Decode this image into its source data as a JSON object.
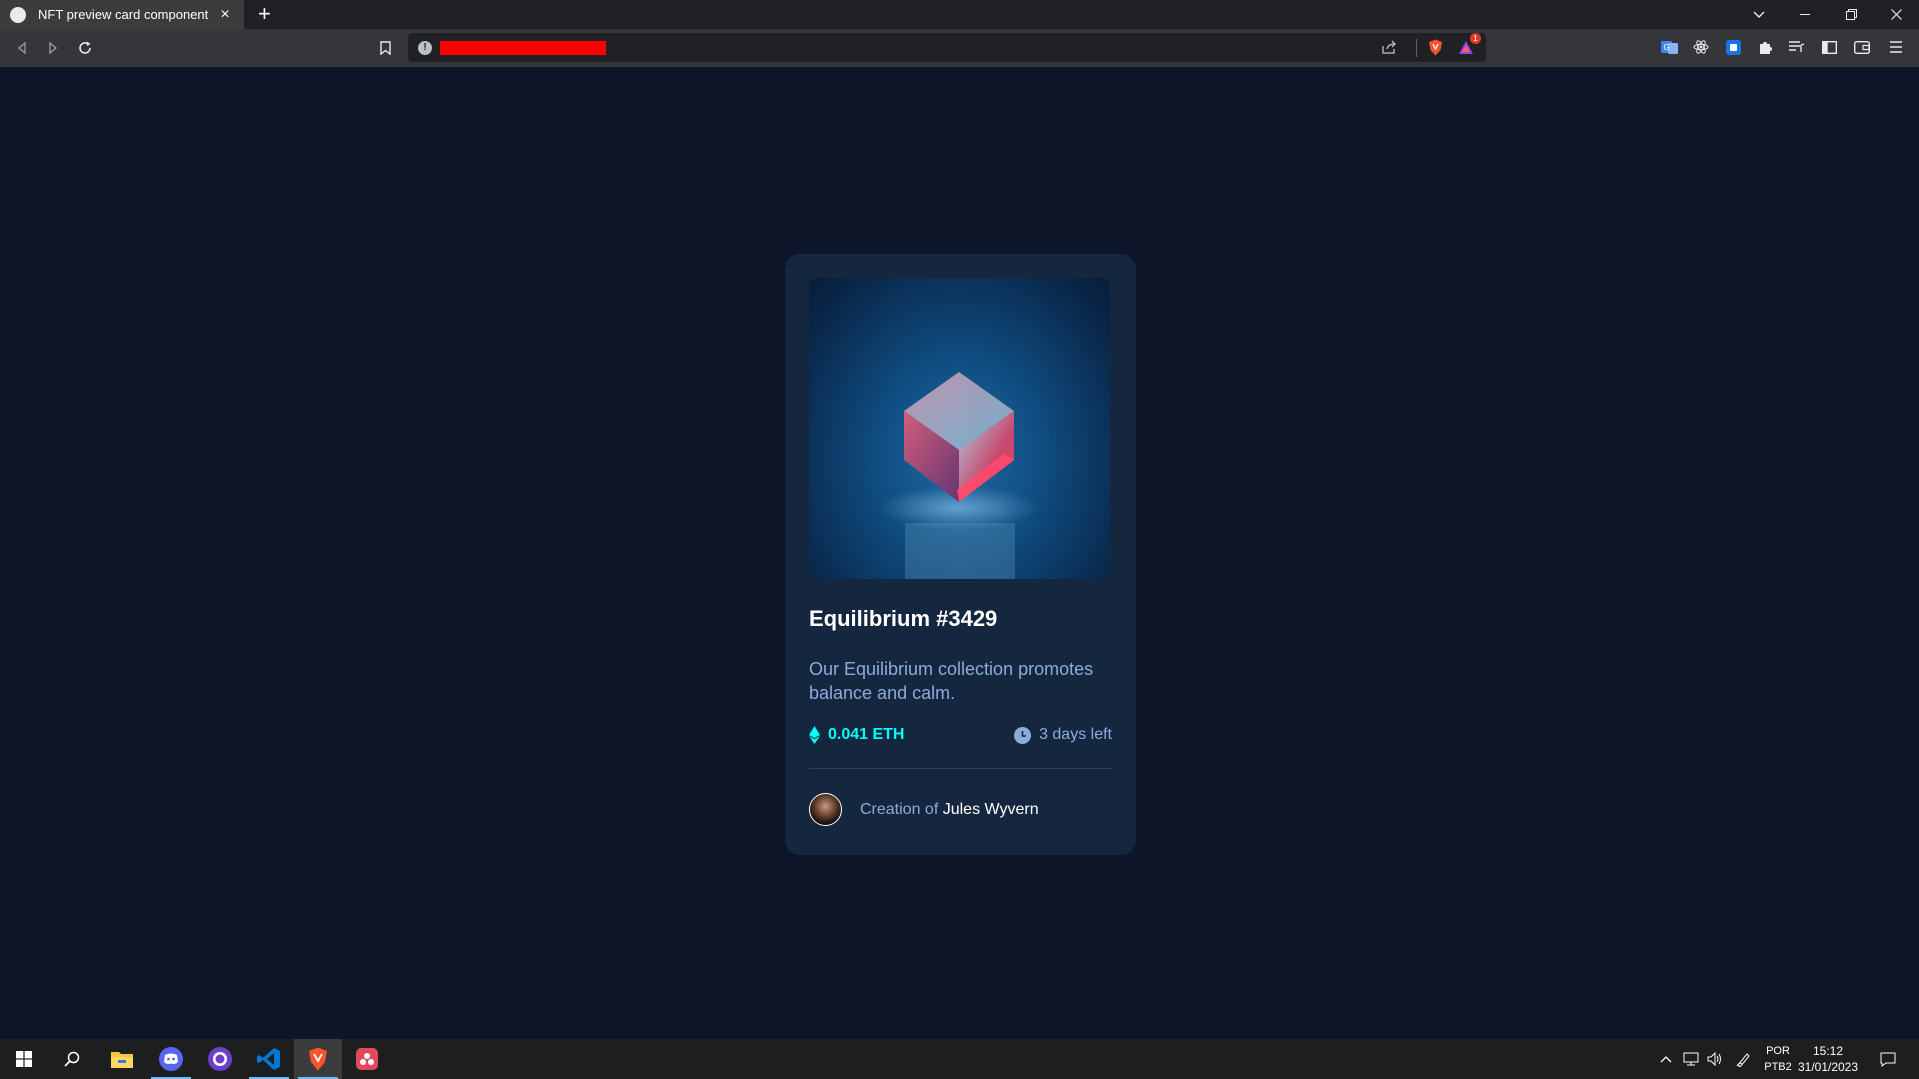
{
  "browser": {
    "tab_title": "NFT preview card component",
    "new_tab_symbol": "+",
    "close_symbol": "×",
    "alert_badge": "1"
  },
  "card": {
    "title": "Equilibrium #3429",
    "description": "Our Equilibrium collection promotes balance and calm.",
    "price": "0.041 ETH",
    "time_left": "3 days left",
    "creator_prefix": "Creation of",
    "creator_name": "Jules Wyvern"
  },
  "taskbar": {
    "lang_top": "POR",
    "lang_bottom": "PTB2",
    "time": "15:12",
    "date": "31/01/2023"
  },
  "colors": {
    "page_bg": "#0d1629",
    "card_bg": "#15263f",
    "cyan": "#00fff8",
    "soft_blue": "#8bacd9",
    "line": "#2e405a"
  }
}
